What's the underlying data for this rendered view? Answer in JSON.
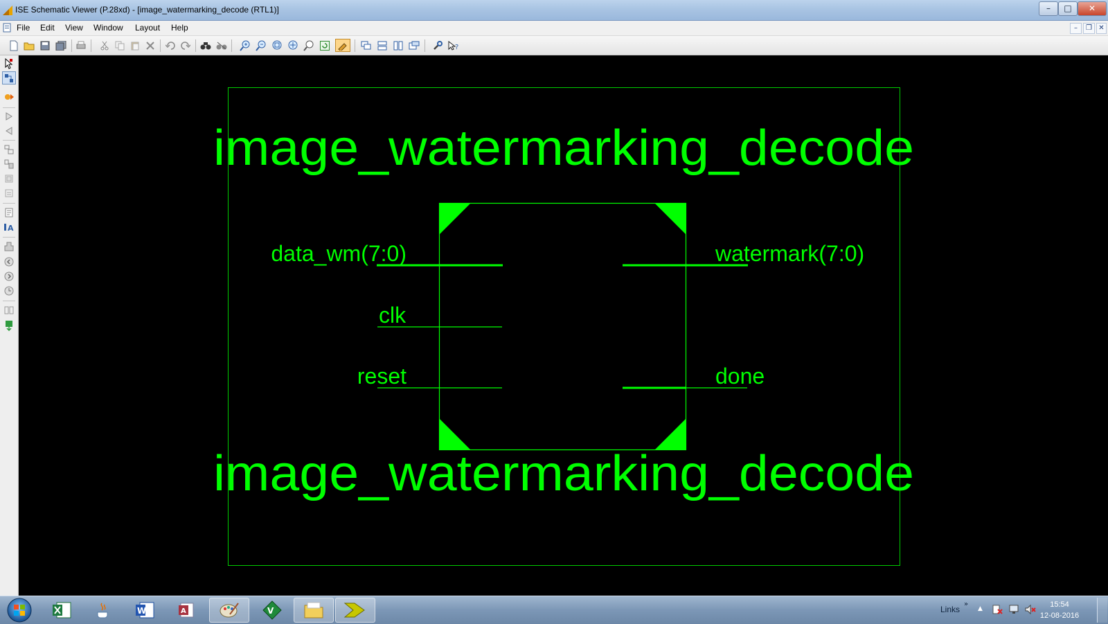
{
  "window": {
    "title": "ISE Schematic Viewer (P.28xd) - [image_watermarking_decode (RTL1)]",
    "controls": {
      "minimize": "–",
      "maximize": "□",
      "close": "✕"
    }
  },
  "menu": {
    "items": [
      "File",
      "Edit",
      "View",
      "Window",
      "Layout",
      "Help"
    ],
    "mdi_controls": {
      "minimize": "–",
      "restore": "❐",
      "close": "✕"
    }
  },
  "toolbar": {
    "icons": [
      "new-file-icon",
      "open-folder-icon",
      "save-icon",
      "save-all-icon",
      "print-icon",
      "cut-icon",
      "copy-icon",
      "paste-icon",
      "delete-icon",
      "undo-icon",
      "redo-icon",
      "find-icon",
      "find-replace-icon",
      "zoom-in-icon",
      "zoom-out-icon",
      "zoom-full-icon",
      "zoom-fit-icon",
      "zoom-select-icon",
      "refresh-icon",
      "highlight-icon",
      "cascade-icon",
      "tile-horizontal-icon",
      "tile-vertical-icon",
      "restore-windows-icon",
      "settings-wrench-icon",
      "help-icon"
    ]
  },
  "schematic": {
    "instance_name_top": "image_watermarking_decode",
    "instance_name_bottom": "image_watermarking_decode",
    "ports": {
      "data_wm": "data_wm(7:0)",
      "clk": "clk",
      "reset": "reset",
      "watermark": "watermark(7:0)",
      "done": "done"
    },
    "colors": {
      "wire": "#00ff00",
      "block_fill": "#00ff00",
      "frame": "#00cc00"
    }
  },
  "taskbar": {
    "apps": [
      "excel-icon",
      "java-icon",
      "word-icon",
      "access-icon",
      "paint-icon",
      "vim-icon",
      "explorer-icon",
      "xilinx-ise-icon"
    ],
    "tray": {
      "links_label": "Links",
      "links_chevron": "»",
      "show_hidden": "▲"
    },
    "clock": {
      "time": "15:54",
      "date": "12-08-2016"
    }
  }
}
